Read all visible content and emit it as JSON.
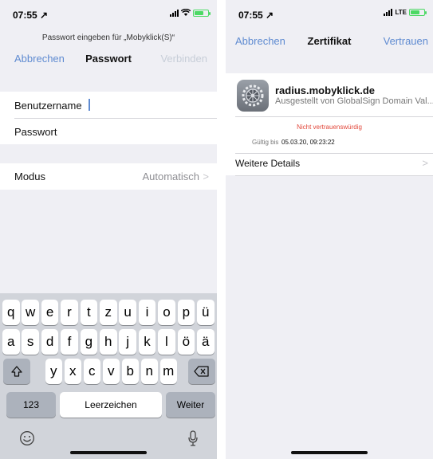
{
  "left": {
    "status": {
      "time": "07:55 ↗"
    },
    "prompt": "Passwort eingeben für „Mobyklick(S)“",
    "nav": {
      "cancel": "Abbrechen",
      "title": "Passwort",
      "connect": "Verbinden"
    },
    "fields": {
      "username_label": "Benutzername",
      "password_label": "Passwort"
    },
    "mode": {
      "label": "Modus",
      "value": "Automatisch",
      "chevron": ">"
    },
    "keyboard": {
      "row1": [
        "q",
        "w",
        "e",
        "r",
        "t",
        "z",
        "u",
        "i",
        "o",
        "p",
        "ü"
      ],
      "row2": [
        "a",
        "s",
        "d",
        "f",
        "g",
        "h",
        "j",
        "k",
        "l",
        "ö",
        "ä"
      ],
      "row3": [
        "y",
        "x",
        "c",
        "v",
        "b",
        "n",
        "m"
      ],
      "numbers_key": "123",
      "space_key": "Leerzeichen",
      "return_key": "Weiter",
      "shift_icon": "shift-icon",
      "backspace_icon": "backspace-icon",
      "emoji_icon": "emoji-icon",
      "mic_icon": "microphone-icon"
    }
  },
  "right": {
    "status": {
      "time": "07:55 ↗",
      "network": "LTE"
    },
    "nav": {
      "cancel": "Abbrechen",
      "title": "Zertifikat",
      "trust": "Vertrauen"
    },
    "certificate": {
      "name": "radius.mobyklick.de",
      "issuer": "Ausgestellt von GlobalSign Domain Val...",
      "warning": "Nicht vertrauenswürdig",
      "valid_until_label": "Gültig bis",
      "valid_until_value": "05.03.20, 09:23:22",
      "icon": "settings-gear-icon"
    },
    "details": {
      "label": "Weitere Details",
      "chevron": ">"
    }
  },
  "colors": {
    "accent": "#5f8bd1",
    "warning": "#e2483b",
    "battery": "#4cd964",
    "background": "#efeff4"
  }
}
